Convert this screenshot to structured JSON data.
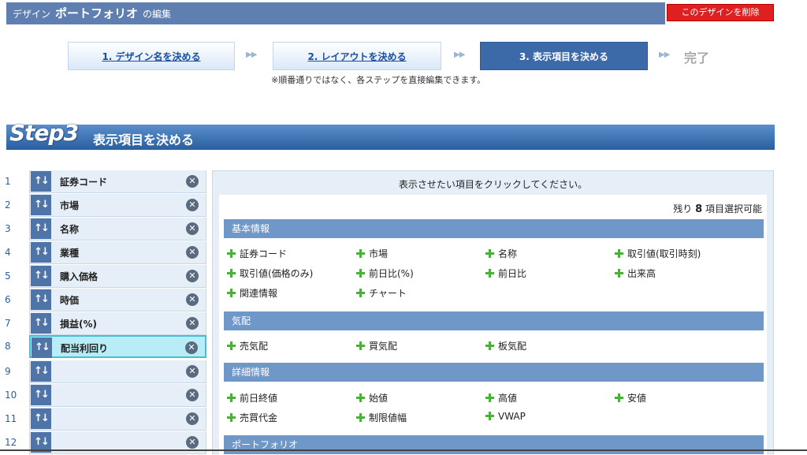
{
  "header": {
    "prefix": "デザイン",
    "portfolio": "ポートフォリオ",
    "suffix": "の編集",
    "delete_button": "このデザインを削除"
  },
  "steps": {
    "step1": "1. デザイン名を決める",
    "step2": "2. レイアウトを決める",
    "step3": "3. 表示項目を決める",
    "done": "完了",
    "arrow": "▶▶",
    "note": "※順番通りではなく、各ステップを直接編集できます。"
  },
  "banner": {
    "big": "Step3",
    "title": "表示項目を決める"
  },
  "list": {
    "rows": [
      {
        "num": "1",
        "label": "証券コード"
      },
      {
        "num": "2",
        "label": "市場"
      },
      {
        "num": "3",
        "label": "名称"
      },
      {
        "num": "4",
        "label": "業種"
      },
      {
        "num": "5",
        "label": "購入価格"
      },
      {
        "num": "6",
        "label": "時価"
      },
      {
        "num": "7",
        "label": "損益(%)"
      },
      {
        "num": "8",
        "label": "配当利回り"
      },
      {
        "num": "9",
        "label": ""
      },
      {
        "num": "10",
        "label": ""
      },
      {
        "num": "11",
        "label": ""
      },
      {
        "num": "12",
        "label": ""
      }
    ],
    "sort_icon": "↑↓",
    "remove_icon": "✕"
  },
  "panel": {
    "instruction": "表示させたい項目をクリックしてください。",
    "remaining_prefix": "残り",
    "remaining_count": "8",
    "remaining_suffix": "項目選択可能",
    "sections": {
      "basic": {
        "title": "基本情報",
        "items": [
          "証券コード",
          "市場",
          "名称",
          "取引値(取引時刻)",
          "取引値(価格のみ)",
          "前日比(%)",
          "前日比",
          "出来高",
          "関連情報",
          "チャート"
        ]
      },
      "quote": {
        "title": "気配",
        "items": [
          "売気配",
          "買気配",
          "板気配"
        ]
      },
      "detail": {
        "title": "詳細情報",
        "items": [
          "前日終値",
          "始値",
          "高値",
          "安値",
          "売買代金",
          "制限値幅",
          "VWAP"
        ]
      },
      "portfolio": {
        "title": "ポートフォリオ"
      }
    }
  },
  "colors": {
    "header_bg": "#5e7fb0",
    "delete_red": "#e02020",
    "active_step": "#3c6aa9",
    "section_bg": "#6f97c8",
    "plus_green": "#4caf3c",
    "selected_row": "#b8ecf6"
  }
}
